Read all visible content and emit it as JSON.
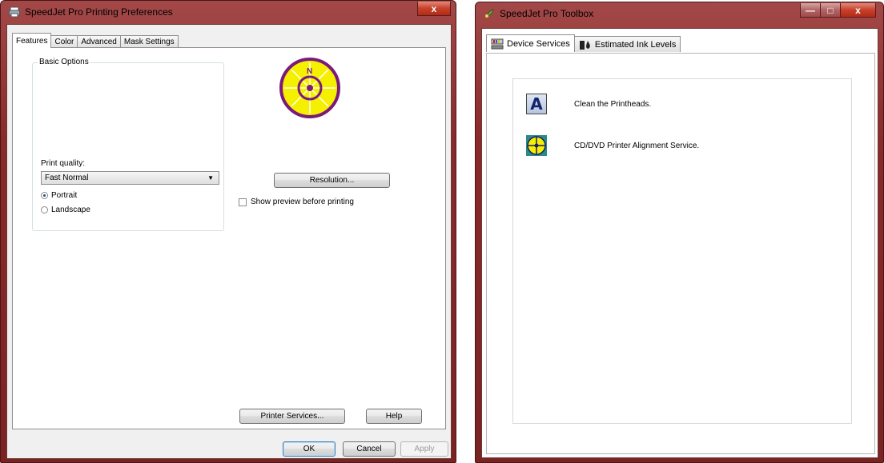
{
  "left_window": {
    "title": "SpeedJet Pro Printing Preferences",
    "close_label": "x",
    "tabs": [
      {
        "label": "Features",
        "active": true
      },
      {
        "label": "Color",
        "active": false
      },
      {
        "label": "Advanced",
        "active": false
      },
      {
        "label": "Mask Settings",
        "active": false
      }
    ],
    "basic_options_title": "Basic Options",
    "print_quality_label": "Print quality:",
    "print_quality_value": "Fast Normal",
    "orientation": {
      "portrait_label": "Portrait",
      "landscape_label": "Landscape",
      "selected": "Portrait"
    },
    "compass_letter": "N",
    "resolution_button": "Resolution...",
    "show_preview_label": "Show preview before printing",
    "show_preview_checked": false,
    "printer_services_button": "Printer Services...",
    "help_button": "Help",
    "ok_button": "OK",
    "cancel_button": "Cancel",
    "apply_button": "Apply"
  },
  "right_window": {
    "title": "SpeedJet Pro Toolbox",
    "minimize_label": "—",
    "maximize_label": "□",
    "close_label": "x",
    "tabs": [
      {
        "label": "Device Services",
        "icon": "device-services-icon",
        "active": true
      },
      {
        "label": "Estimated Ink Levels",
        "icon": "ink-levels-icon",
        "active": false
      }
    ],
    "services": [
      {
        "label": "Clean the Printheads.",
        "icon": "printhead-clean-icon",
        "glyph": "A"
      },
      {
        "label": "CD/DVD Printer Alignment Service.",
        "icon": "cd-alignment-icon",
        "glyph": ""
      }
    ]
  },
  "colors": {
    "titlebar": "#8a2a2a",
    "client_bg": "#f0f0f0",
    "compass_yellow": "#f4f000",
    "compass_ring": "#7b1a7b"
  }
}
